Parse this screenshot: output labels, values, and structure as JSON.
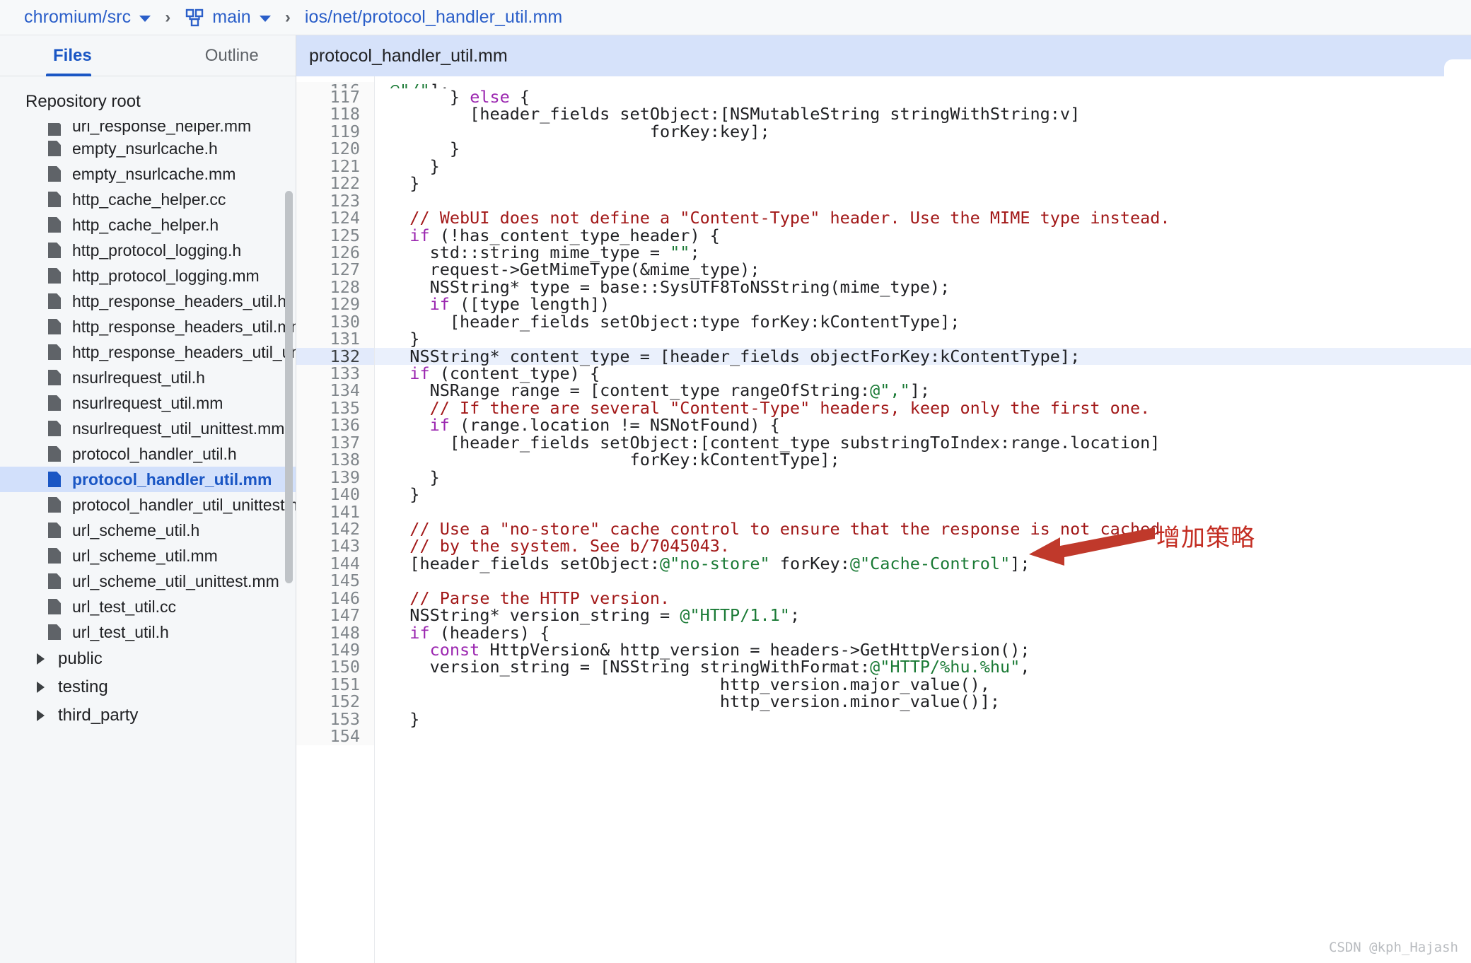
{
  "breadcrumb": {
    "repo": "chromium/src",
    "branch": "main",
    "path": "ios/net/protocol_handler_util.mm",
    "separator": "›",
    "branch_icon": "git-branch-icon",
    "repo_caret_icon": "chevron-down-icon",
    "branch_caret_icon": "chevron-down-icon"
  },
  "sidebar": {
    "tabs": [
      {
        "label": "Files",
        "active": true
      },
      {
        "label": "Outline",
        "active": false
      }
    ],
    "collapse_icon": "❮|",
    "root_label": "Repository root",
    "files": [
      {
        "name": "url_response_helper.mm",
        "selected": false,
        "clipped": true
      },
      {
        "name": "empty_nsurlcache.h",
        "selected": false
      },
      {
        "name": "empty_nsurlcache.mm",
        "selected": false
      },
      {
        "name": "http_cache_helper.cc",
        "selected": false
      },
      {
        "name": "http_cache_helper.h",
        "selected": false
      },
      {
        "name": "http_protocol_logging.h",
        "selected": false
      },
      {
        "name": "http_protocol_logging.mm",
        "selected": false
      },
      {
        "name": "http_response_headers_util.h",
        "selected": false
      },
      {
        "name": "http_response_headers_util.mm",
        "selected": false
      },
      {
        "name": "http_response_headers_util_unitt",
        "selected": false
      },
      {
        "name": "nsurlrequest_util.h",
        "selected": false
      },
      {
        "name": "nsurlrequest_util.mm",
        "selected": false
      },
      {
        "name": "nsurlrequest_util_unittest.mm",
        "selected": false
      },
      {
        "name": "protocol_handler_util.h",
        "selected": false
      },
      {
        "name": "protocol_handler_util.mm",
        "selected": true
      },
      {
        "name": "protocol_handler_util_unittest.mr",
        "selected": false
      },
      {
        "name": "url_scheme_util.h",
        "selected": false
      },
      {
        "name": "url_scheme_util.mm",
        "selected": false
      },
      {
        "name": "url_scheme_util_unittest.mm",
        "selected": false
      },
      {
        "name": "url_test_util.cc",
        "selected": false
      },
      {
        "name": "url_test_util.h",
        "selected": false
      }
    ],
    "directories": [
      {
        "name": "public"
      },
      {
        "name": "testing"
      },
      {
        "name": "third_party"
      }
    ]
  },
  "editor": {
    "tab_label": "protocol_handler_util.mm",
    "highlighted_line": 132,
    "first_line_number": 117,
    "lines": [
      {
        "n": 117,
        "tokens": [
          {
            "t": "      } "
          },
          {
            "t": "else",
            "c": "kw"
          },
          {
            "t": " {"
          }
        ]
      },
      {
        "n": 118,
        "tokens": [
          {
            "t": "        [header_fields setObject:[NSMutableString stringWithString:v]"
          }
        ]
      },
      {
        "n": 119,
        "tokens": [
          {
            "t": "                          forKey:key];"
          }
        ]
      },
      {
        "n": 120,
        "tokens": [
          {
            "t": "      }"
          }
        ]
      },
      {
        "n": 121,
        "tokens": [
          {
            "t": "    }"
          }
        ]
      },
      {
        "n": 122,
        "tokens": [
          {
            "t": "  }"
          }
        ]
      },
      {
        "n": 123,
        "tokens": [
          {
            "t": ""
          }
        ]
      },
      {
        "n": 124,
        "tokens": [
          {
            "t": "  // WebUI does not define a \"Content-Type\" header. Use the MIME type instead.",
            "c": "cm"
          }
        ]
      },
      {
        "n": 125,
        "tokens": [
          {
            "t": "  "
          },
          {
            "t": "if",
            "c": "kw"
          },
          {
            "t": " (!has_content_type_header) {"
          }
        ]
      },
      {
        "n": 126,
        "tokens": [
          {
            "t": "    std::string mime_type = "
          },
          {
            "t": "\"\"",
            "c": "st"
          },
          {
            "t": ";"
          }
        ]
      },
      {
        "n": 127,
        "tokens": [
          {
            "t": "    request->GetMimeType(&mime_type);"
          }
        ]
      },
      {
        "n": 128,
        "tokens": [
          {
            "t": "    NSString* type = base::SysUTF8ToNSString(mime_type);"
          }
        ]
      },
      {
        "n": 129,
        "tokens": [
          {
            "t": "    "
          },
          {
            "t": "if",
            "c": "kw"
          },
          {
            "t": " ([type length])"
          }
        ]
      },
      {
        "n": 130,
        "tokens": [
          {
            "t": "      [header_fields setObject:type forKey:kContentType];"
          }
        ]
      },
      {
        "n": 131,
        "tokens": [
          {
            "t": "  }"
          }
        ]
      },
      {
        "n": 132,
        "tokens": [
          {
            "t": "  NSString* content_type = [header_fields objectForKey:kContentType];"
          }
        ]
      },
      {
        "n": 133,
        "tokens": [
          {
            "t": "  "
          },
          {
            "t": "if",
            "c": "kw"
          },
          {
            "t": " (content_type) {"
          }
        ]
      },
      {
        "n": 134,
        "tokens": [
          {
            "t": "    NSRange range = [content_type rangeOfString:"
          },
          {
            "t": "@\",\"",
            "c": "st"
          },
          {
            "t": "];"
          }
        ]
      },
      {
        "n": 135,
        "tokens": [
          {
            "t": "    // If there are several \"Content-Type\" headers, keep only the first one.",
            "c": "cm"
          }
        ]
      },
      {
        "n": 136,
        "tokens": [
          {
            "t": "    "
          },
          {
            "t": "if",
            "c": "kw"
          },
          {
            "t": " (range.location != NSNotFound) {"
          }
        ]
      },
      {
        "n": 137,
        "tokens": [
          {
            "t": "      [header_fields setObject:[content_type substringToIndex:range.location]"
          }
        ]
      },
      {
        "n": 138,
        "tokens": [
          {
            "t": "                        forKey:kContentType];"
          }
        ]
      },
      {
        "n": 139,
        "tokens": [
          {
            "t": "    }"
          }
        ]
      },
      {
        "n": 140,
        "tokens": [
          {
            "t": "  }"
          }
        ]
      },
      {
        "n": 141,
        "tokens": [
          {
            "t": ""
          }
        ]
      },
      {
        "n": 142,
        "tokens": [
          {
            "t": "  // Use a \"no-store\" cache control to ensure that the response is not cached",
            "c": "cm"
          }
        ]
      },
      {
        "n": 143,
        "tokens": [
          {
            "t": "  // by the system. See b/7045043.",
            "c": "cm"
          }
        ]
      },
      {
        "n": 144,
        "tokens": [
          {
            "t": "  [header_fields setObject:"
          },
          {
            "t": "@\"no-store\"",
            "c": "st"
          },
          {
            "t": " forKey:"
          },
          {
            "t": "@\"Cache-Control\"",
            "c": "st"
          },
          {
            "t": "];"
          }
        ]
      },
      {
        "n": 145,
        "tokens": [
          {
            "t": ""
          }
        ]
      },
      {
        "n": 146,
        "tokens": [
          {
            "t": "  // Parse the HTTP version.",
            "c": "cm"
          }
        ]
      },
      {
        "n": 147,
        "tokens": [
          {
            "t": "  NSString* version_string = "
          },
          {
            "t": "@\"HTTP/1.1\"",
            "c": "st"
          },
          {
            "t": ";"
          }
        ]
      },
      {
        "n": 148,
        "tokens": [
          {
            "t": "  "
          },
          {
            "t": "if",
            "c": "kw"
          },
          {
            "t": " (headers) {"
          }
        ]
      },
      {
        "n": 149,
        "tokens": [
          {
            "t": "    "
          },
          {
            "t": "const",
            "c": "kw"
          },
          {
            "t": " HttpVersion& http_version = headers->GetHttpVersion();"
          }
        ]
      },
      {
        "n": 150,
        "tokens": [
          {
            "t": "    version_string = [NSString stringWithFormat:"
          },
          {
            "t": "@\"HTTP/%hu.%hu\"",
            "c": "st"
          },
          {
            "t": ","
          }
        ]
      },
      {
        "n": 151,
        "tokens": [
          {
            "t": "                                 http_version.major_value(),"
          }
        ]
      },
      {
        "n": 152,
        "tokens": [
          {
            "t": "                                 http_version.minor_value()];"
          }
        ]
      },
      {
        "n": 153,
        "tokens": [
          {
            "t": "  }"
          }
        ]
      },
      {
        "n": 154,
        "tokens": [
          {
            "t": ""
          }
        ]
      }
    ]
  },
  "annotation": {
    "text": "增加策略",
    "color": "#c32d22",
    "arrow_icon": "left-arrow-annotation-icon",
    "points_to_line": 133
  },
  "watermark": {
    "text": "CSDN @kph_Hajash"
  },
  "colors": {
    "accent": "#1a56c4",
    "selection": "#d2e0fb",
    "editor_tab_bg": "#d6e2fa",
    "comment": "#a21818",
    "keyword": "#9b27b0",
    "string": "#1a7a35",
    "annotation_red": "#c32d22"
  }
}
